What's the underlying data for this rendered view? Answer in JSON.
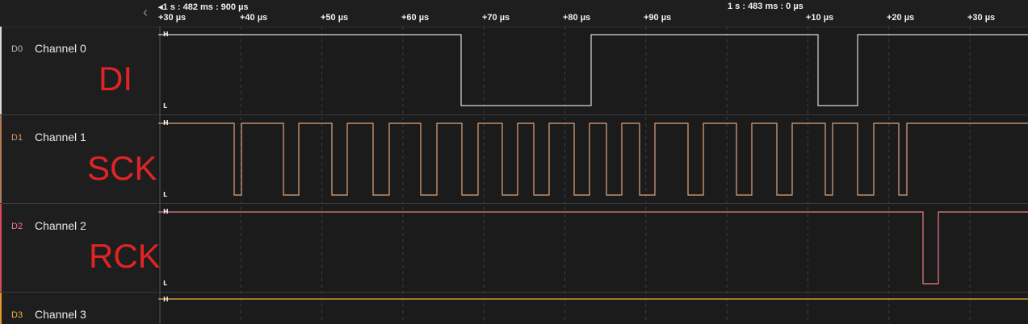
{
  "timeline": {
    "abs_start": "◂1 s : 482 ms : 900 µs",
    "abs_mid": "1 s : 483 ms : 0 µs",
    "ticks": [
      "+30 µs",
      "+40 µs",
      "+50 µs",
      "+60 µs",
      "+70 µs",
      "+80 µs",
      "+90 µs",
      "+10 µs",
      "+20 µs",
      "+30 µs"
    ]
  },
  "collapse_icon": "‹",
  "channels": [
    {
      "id": "D0",
      "name": "Channel 0",
      "annotation": "DI",
      "color": "#d9d9d9",
      "high": "H",
      "low": "L"
    },
    {
      "id": "D1",
      "name": "Channel 1",
      "annotation": "SCK",
      "color": "#e0a77e",
      "high": "H",
      "low": "L"
    },
    {
      "id": "D2",
      "name": "Channel 2",
      "annotation": "RCK",
      "color": "#f07c88",
      "high": "H",
      "low": "L"
    },
    {
      "id": "D3",
      "name": "Channel 3",
      "annotation": "",
      "color": "#f5b13d",
      "high": "H",
      "low": ""
    }
  ],
  "signals": {
    "ch0": [
      [
        0,
        1
      ],
      [
        571,
        0
      ],
      [
        732,
        1
      ],
      [
        1013,
        0
      ],
      [
        1062,
        1
      ]
    ],
    "ch1": [
      [
        0,
        1
      ],
      [
        290,
        0
      ],
      [
        299,
        1
      ],
      [
        351,
        0
      ],
      [
        370,
        1
      ],
      [
        411,
        0
      ],
      [
        430,
        1
      ],
      [
        462,
        0
      ],
      [
        482,
        1
      ],
      [
        521,
        0
      ],
      [
        541,
        1
      ],
      [
        572,
        0
      ],
      [
        592,
        1
      ],
      [
        622,
        0
      ],
      [
        641,
        1
      ],
      [
        661,
        0
      ],
      [
        680,
        1
      ],
      [
        711,
        0
      ],
      [
        730,
        1
      ],
      [
        751,
        0
      ],
      [
        770,
        1
      ],
      [
        792,
        0
      ],
      [
        811,
        1
      ],
      [
        852,
        0
      ],
      [
        871,
        1
      ],
      [
        912,
        0
      ],
      [
        931,
        1
      ],
      [
        962,
        0
      ],
      [
        981,
        1
      ],
      [
        1022,
        0
      ],
      [
        1031,
        1
      ],
      [
        1062,
        0
      ],
      [
        1082,
        1
      ],
      [
        1113,
        0
      ],
      [
        1123,
        1
      ]
    ],
    "ch2": [
      [
        0,
        1
      ],
      [
        1143,
        0
      ],
      [
        1162,
        1
      ]
    ],
    "ch3": [
      [
        0,
        1
      ]
    ]
  }
}
